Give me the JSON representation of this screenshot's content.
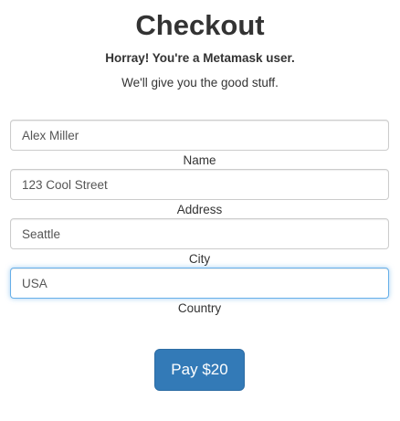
{
  "header": {
    "title": "Checkout",
    "subtitle": "Horray! You're a Metamask user.",
    "tagline": "We'll give you the good stuff."
  },
  "form": {
    "fields": [
      {
        "label": "Name",
        "value": "Alex Miller",
        "focused": false
      },
      {
        "label": "Address",
        "value": "123 Cool Street",
        "focused": false
      },
      {
        "label": "City",
        "value": "Seattle",
        "focused": false
      },
      {
        "label": "Country",
        "value": "USA",
        "focused": true
      }
    ],
    "pay_label": "Pay $20"
  },
  "colors": {
    "primary": "#337ab7",
    "focus_border": "#66afe9",
    "text": "#333333"
  }
}
